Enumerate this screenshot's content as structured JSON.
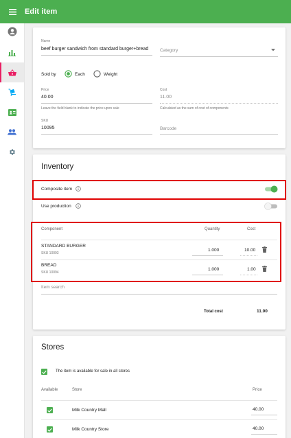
{
  "header": {
    "title": "Edit item"
  },
  "item": {
    "name_label": "Name",
    "name_value": "beef burger sandwich from standard burger+bread",
    "category_placeholder": "Category",
    "sold_by_label": "Sold by",
    "sold_by_each": "Each",
    "sold_by_weight": "Weight",
    "sold_by_selected": "Each",
    "price_label": "Price",
    "price_value": "40.00",
    "price_hint": "Leave the field blank to indicate the price upon sale",
    "cost_label": "Cost",
    "cost_value": "11.00",
    "cost_hint": "Calculated as the sum of cost of components",
    "sku_label": "SKU",
    "sku_value": "10095",
    "barcode_placeholder": "Barcode"
  },
  "inventory": {
    "heading": "Inventory",
    "composite_label": "Composite item",
    "composite_on": true,
    "production_label": "Use production",
    "production_on": false,
    "table": {
      "col_component": "Component",
      "col_quantity": "Quantity",
      "col_cost": "Cost",
      "rows": [
        {
          "name": "STANDARD BURGER",
          "sku": "SKU 10093",
          "quantity": "1.000",
          "cost": "10.00"
        },
        {
          "name": "BREAD",
          "sku": "SKU 10094",
          "quantity": "1.000",
          "cost": "1.00"
        }
      ]
    },
    "item_search_placeholder": "Item search",
    "total_cost_label": "Total cost",
    "total_cost_value": "11.00"
  },
  "stores": {
    "heading": "Stores",
    "all_stores_label": "The item is available for sale in all stores",
    "col_available": "Available",
    "col_store": "Store",
    "col_price": "Price",
    "rows": [
      {
        "store": "Milk Country Mall",
        "price": "40.00",
        "available": true
      },
      {
        "store": "Milk Country Store",
        "price": "40.00",
        "available": true
      }
    ]
  },
  "colors": {
    "brand_green": "#4caf50",
    "active_pink": "#e91e63",
    "highlight_red": "#e00000"
  },
  "icons": {
    "sidebar": [
      "account-circle-icon",
      "bar-chart-icon",
      "basket-icon",
      "dolly-icon",
      "id-card-icon",
      "people-icon",
      "gear-icon"
    ]
  }
}
